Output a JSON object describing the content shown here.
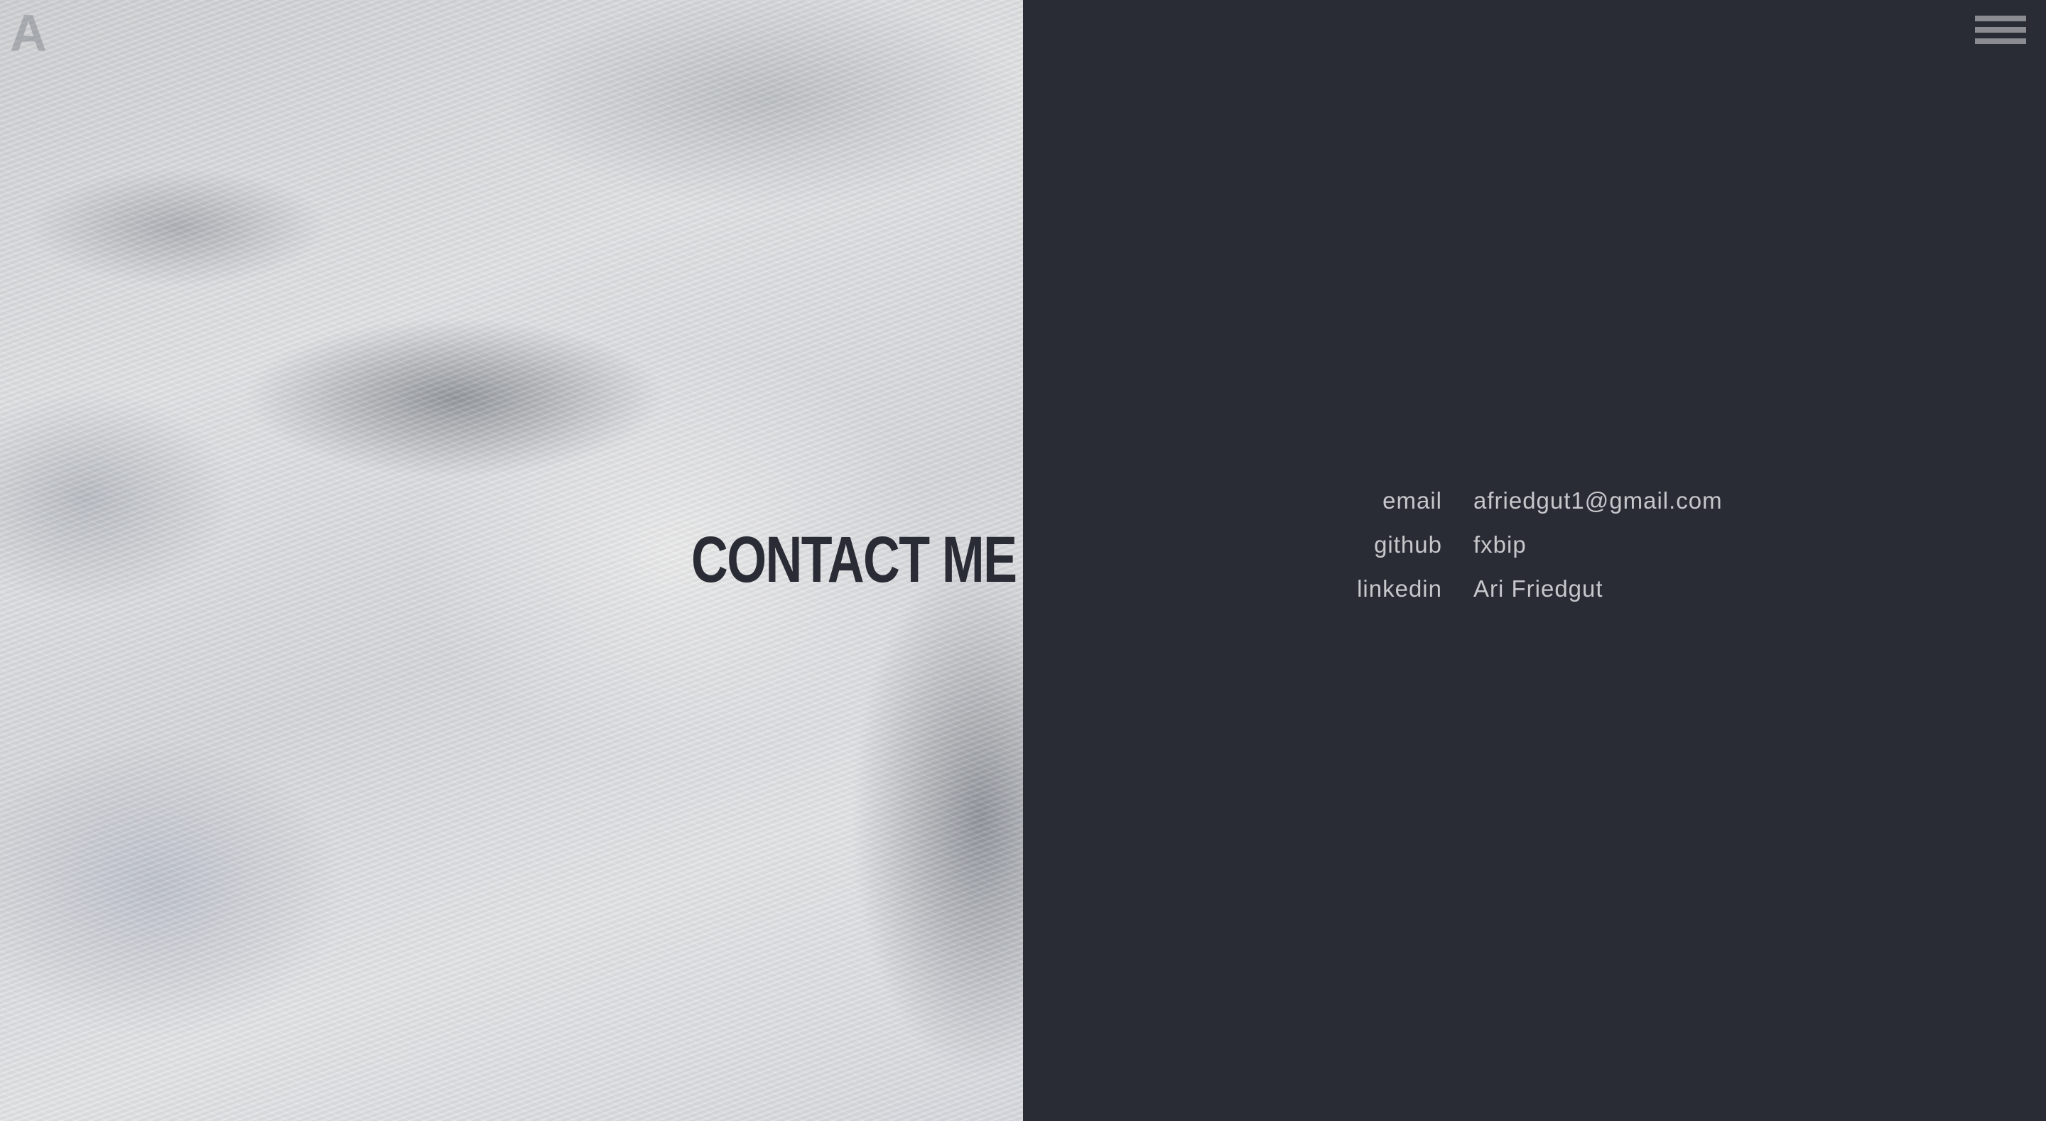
{
  "logo": {
    "text": "A"
  },
  "page_title": "CONTACT ME",
  "menu": {
    "icon": "hamburger-menu-icon"
  },
  "contacts": [
    {
      "label": "email",
      "value": "afriedgut1@gmail.com"
    },
    {
      "label": "github",
      "value": "fxbip"
    },
    {
      "label": "linkedin",
      "value": "Ari Friedgut"
    }
  ],
  "colors": {
    "dark_background": "#292c35",
    "text_light": "#c6c7cb",
    "title_dark": "#292c35",
    "menu_icon": "#8a8c92"
  }
}
